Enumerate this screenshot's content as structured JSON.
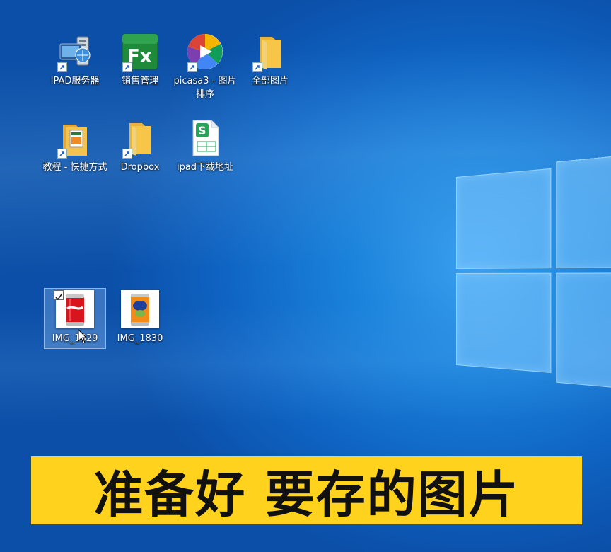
{
  "desktop": {
    "icons": [
      {
        "label": "IPAD服务器"
      },
      {
        "label": "销售管理"
      },
      {
        "label": "picasa3 - 图片排序"
      },
      {
        "label": "全部图片"
      },
      {
        "label": "教程 - 快捷方式"
      },
      {
        "label": "Dropbox"
      },
      {
        "label": "ipad下载地址"
      },
      {
        "label": "IMG_1829"
      },
      {
        "label": "IMG_1830"
      }
    ]
  },
  "caption": {
    "text": "准备好 要存的图片"
  },
  "colors": {
    "caption_bg": "#ffd21d",
    "folder": "#f7c547",
    "fx_green": "#1e8a3a"
  }
}
